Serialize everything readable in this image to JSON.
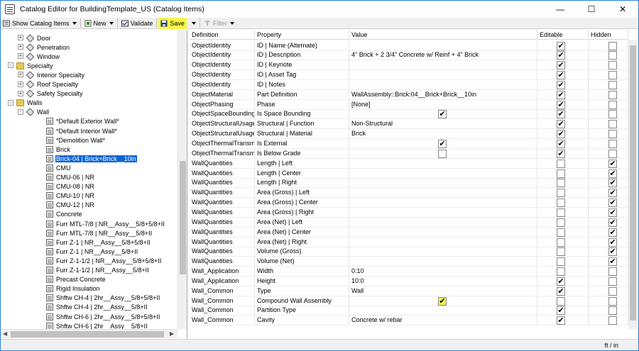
{
  "window": {
    "title": "Catalog Editor for BuildingTemplate_US (Catalog Items)"
  },
  "toolbar": {
    "show_catalog_items": "Show Catalog Items",
    "new": "New",
    "validate": "Validate",
    "save": "Save",
    "filter": "Filter"
  },
  "tree": {
    "items": [
      {
        "label": "Door",
        "kind": "cube",
        "level": 2,
        "expander": "+"
      },
      {
        "label": "Penetration",
        "kind": "cube",
        "level": 2,
        "expander": "+"
      },
      {
        "label": "Window",
        "kind": "cube",
        "level": 2,
        "expander": "+"
      },
      {
        "label": "Specialty",
        "kind": "folder",
        "level": 1,
        "expander": "-"
      },
      {
        "label": "Interior Specialty",
        "kind": "cube",
        "level": 2,
        "expander": "+"
      },
      {
        "label": "Roof Specialty",
        "kind": "cube",
        "level": 2,
        "expander": "+"
      },
      {
        "label": "Safety Specialty",
        "kind": "cube",
        "level": 2,
        "expander": "+"
      },
      {
        "label": "Walls",
        "kind": "folder",
        "level": 1,
        "expander": "-"
      },
      {
        "label": "Wall",
        "kind": "cube",
        "level": 2,
        "expander": "-"
      },
      {
        "label": "*Default Exterior Wall*",
        "kind": "item",
        "level": 3
      },
      {
        "label": "*Default Interior Wall*",
        "kind": "item",
        "level": 3
      },
      {
        "label": "*Demolition Wall*",
        "kind": "item",
        "level": 3
      },
      {
        "label": "Brick",
        "kind": "item",
        "level": 3
      },
      {
        "label": "Brick-04 | Brick+Brick__10in",
        "kind": "item",
        "level": 3,
        "selected": true
      },
      {
        "label": "CMU",
        "kind": "item",
        "level": 3
      },
      {
        "label": "CMU-06 | NR",
        "kind": "item",
        "level": 3
      },
      {
        "label": "CMU-08 | NR",
        "kind": "item",
        "level": 3
      },
      {
        "label": "CMU-10 | NR",
        "kind": "item",
        "level": 3
      },
      {
        "label": "CMU-12 | NR",
        "kind": "item",
        "level": 3
      },
      {
        "label": "Concrete",
        "kind": "item",
        "level": 3
      },
      {
        "label": "Furr MTL-7/8 | NR__Assy__5/8+5/8+II",
        "kind": "item",
        "level": 3
      },
      {
        "label": "Furr MTL-7/8 | NR__Assy__5/8+II",
        "kind": "item",
        "level": 3
      },
      {
        "label": "Furr Z-1 | NR__Assy__5/8+5/8+II",
        "kind": "item",
        "level": 3
      },
      {
        "label": "Furr Z-1 | NR__Assy__5/8+II",
        "kind": "item",
        "level": 3
      },
      {
        "label": "Furr Z-1-1/2 | NR__Assy__5/8+5/8+II",
        "kind": "item",
        "level": 3
      },
      {
        "label": "Furr Z-1-1/2 | NR__Assy__5/8+II",
        "kind": "item",
        "level": 3
      },
      {
        "label": "Precast Concrete",
        "kind": "item",
        "level": 3
      },
      {
        "label": "Rigid Insulation",
        "kind": "item",
        "level": 3
      },
      {
        "label": "Shftw CH-4 | 2hr__Assy__5/8+5/8+II",
        "kind": "item",
        "level": 3
      },
      {
        "label": "Shftw CH-4 | 2hr__Assy__5/8+II",
        "kind": "item",
        "level": 3
      },
      {
        "label": "Shftw CH-6 | 2hr__Assy__5/8+5/8+II",
        "kind": "item",
        "level": 3
      },
      {
        "label": "Shftw CH-6 | 2hr__Assy__5/8+II",
        "kind": "item",
        "level": 3
      }
    ]
  },
  "grid": {
    "headers": {
      "definition": "Definition",
      "property": "Property",
      "value": "Value",
      "editable": "Editable",
      "hidden": "Hidden"
    },
    "rows": [
      {
        "definition": "ObjectIdentity",
        "property": "ID | Name (Alternate)",
        "value": "",
        "value_cb": null,
        "editable": true,
        "hidden": false
      },
      {
        "definition": "ObjectIdentity",
        "property": "ID | Description",
        "value": "4\" Brick + 2 3/4\" Concrete w/ Reinf + 4\" Brick",
        "value_cb": null,
        "editable": true,
        "hidden": false
      },
      {
        "definition": "ObjectIdentity",
        "property": "ID | Keynote",
        "value": "",
        "value_cb": null,
        "editable": true,
        "hidden": false
      },
      {
        "definition": "ObjectIdentity",
        "property": "ID | Asset Tag",
        "value": "",
        "value_cb": null,
        "editable": true,
        "hidden": false
      },
      {
        "definition": "ObjectIdentity",
        "property": "ID | Notes",
        "value": "",
        "value_cb": null,
        "editable": true,
        "hidden": false
      },
      {
        "definition": "ObjectMaterial",
        "property": "Part Definition",
        "value": "WallAssembly::Brick:04__Brick+Brick__10in",
        "value_cb": null,
        "editable": true,
        "hidden": false
      },
      {
        "definition": "ObjectPhasing",
        "property": "Phase",
        "value": "[None]",
        "value_cb": null,
        "editable": true,
        "hidden": false
      },
      {
        "definition": "ObjectSpaceBounding",
        "property": "Is Space Bounding",
        "value": "",
        "value_cb": true,
        "editable": true,
        "hidden": false
      },
      {
        "definition": "ObjectStructuralUsage",
        "property": "Structural | Function",
        "value": "Non-Structural",
        "value_cb": null,
        "editable": true,
        "hidden": false
      },
      {
        "definition": "ObjectStructuralUsage",
        "property": "Structural | Material",
        "value": "Brick",
        "value_cb": null,
        "editable": true,
        "hidden": false
      },
      {
        "definition": "ObjectThermalTransm",
        "property": "Is External",
        "value": "",
        "value_cb": true,
        "editable": true,
        "hidden": false
      },
      {
        "definition": "ObjectThermalTransm",
        "property": "Is Below Grade",
        "value": "",
        "value_cb": false,
        "editable": true,
        "hidden": false
      },
      {
        "definition": "WallQuantities",
        "property": "Length | Left",
        "value": "",
        "value_cb": null,
        "editable": false,
        "hidden": true
      },
      {
        "definition": "WallQuantities",
        "property": "Length | Center",
        "value": "",
        "value_cb": null,
        "editable": false,
        "hidden": true
      },
      {
        "definition": "WallQuantities",
        "property": "Length | Right",
        "value": "",
        "value_cb": null,
        "editable": false,
        "hidden": true
      },
      {
        "definition": "WallQuantities",
        "property": "Area (Gross) | Left",
        "value": "",
        "value_cb": null,
        "editable": false,
        "hidden": true
      },
      {
        "definition": "WallQuantities",
        "property": "Area (Gross) | Center",
        "value": "",
        "value_cb": null,
        "editable": false,
        "hidden": true
      },
      {
        "definition": "WallQuantities",
        "property": "Area (Gross) | Right",
        "value": "",
        "value_cb": null,
        "editable": false,
        "hidden": true
      },
      {
        "definition": "WallQuantities",
        "property": "Area (Net) | Left",
        "value": "",
        "value_cb": null,
        "editable": false,
        "hidden": true
      },
      {
        "definition": "WallQuantities",
        "property": "Area (Net) | Center",
        "value": "",
        "value_cb": null,
        "editable": false,
        "hidden": true
      },
      {
        "definition": "WallQuantities",
        "property": "Area (Net) | Right",
        "value": "",
        "value_cb": null,
        "editable": false,
        "hidden": true
      },
      {
        "definition": "WallQuantities",
        "property": "Volume (Gross)",
        "value": "",
        "value_cb": null,
        "editable": false,
        "hidden": true
      },
      {
        "definition": "WallQuantities",
        "property": "Volume (Net)",
        "value": "",
        "value_cb": null,
        "editable": false,
        "hidden": true
      },
      {
        "definition": "Wall_Application",
        "property": "Width",
        "value": "0:10",
        "value_cb": null,
        "editable": false,
        "hidden": false
      },
      {
        "definition": "Wall_Application",
        "property": "Height",
        "value": "10:0",
        "value_cb": null,
        "editable": true,
        "hidden": false
      },
      {
        "definition": "Wall_Common",
        "property": "Type",
        "value": "Wall",
        "value_cb": null,
        "editable": true,
        "hidden": false
      },
      {
        "definition": "Wall_Common",
        "property": "Compound Wall Assembly",
        "value": "",
        "value_cb": true,
        "value_cb_highlight": true,
        "editable": false,
        "hidden": false
      },
      {
        "definition": "Wall_Common",
        "property": "Partition Type",
        "value": "",
        "value_cb": null,
        "editable": true,
        "hidden": false
      },
      {
        "definition": "Wall_Common",
        "property": "Cavity",
        "value": "Concrete w/ rebar",
        "value_cb": null,
        "editable": true,
        "hidden": false
      }
    ]
  },
  "status": {
    "units": "ft / in"
  },
  "colors": {
    "highlight": "#f7f74a",
    "selection": "#0a64d6",
    "window_border": "#2b7fd4"
  }
}
